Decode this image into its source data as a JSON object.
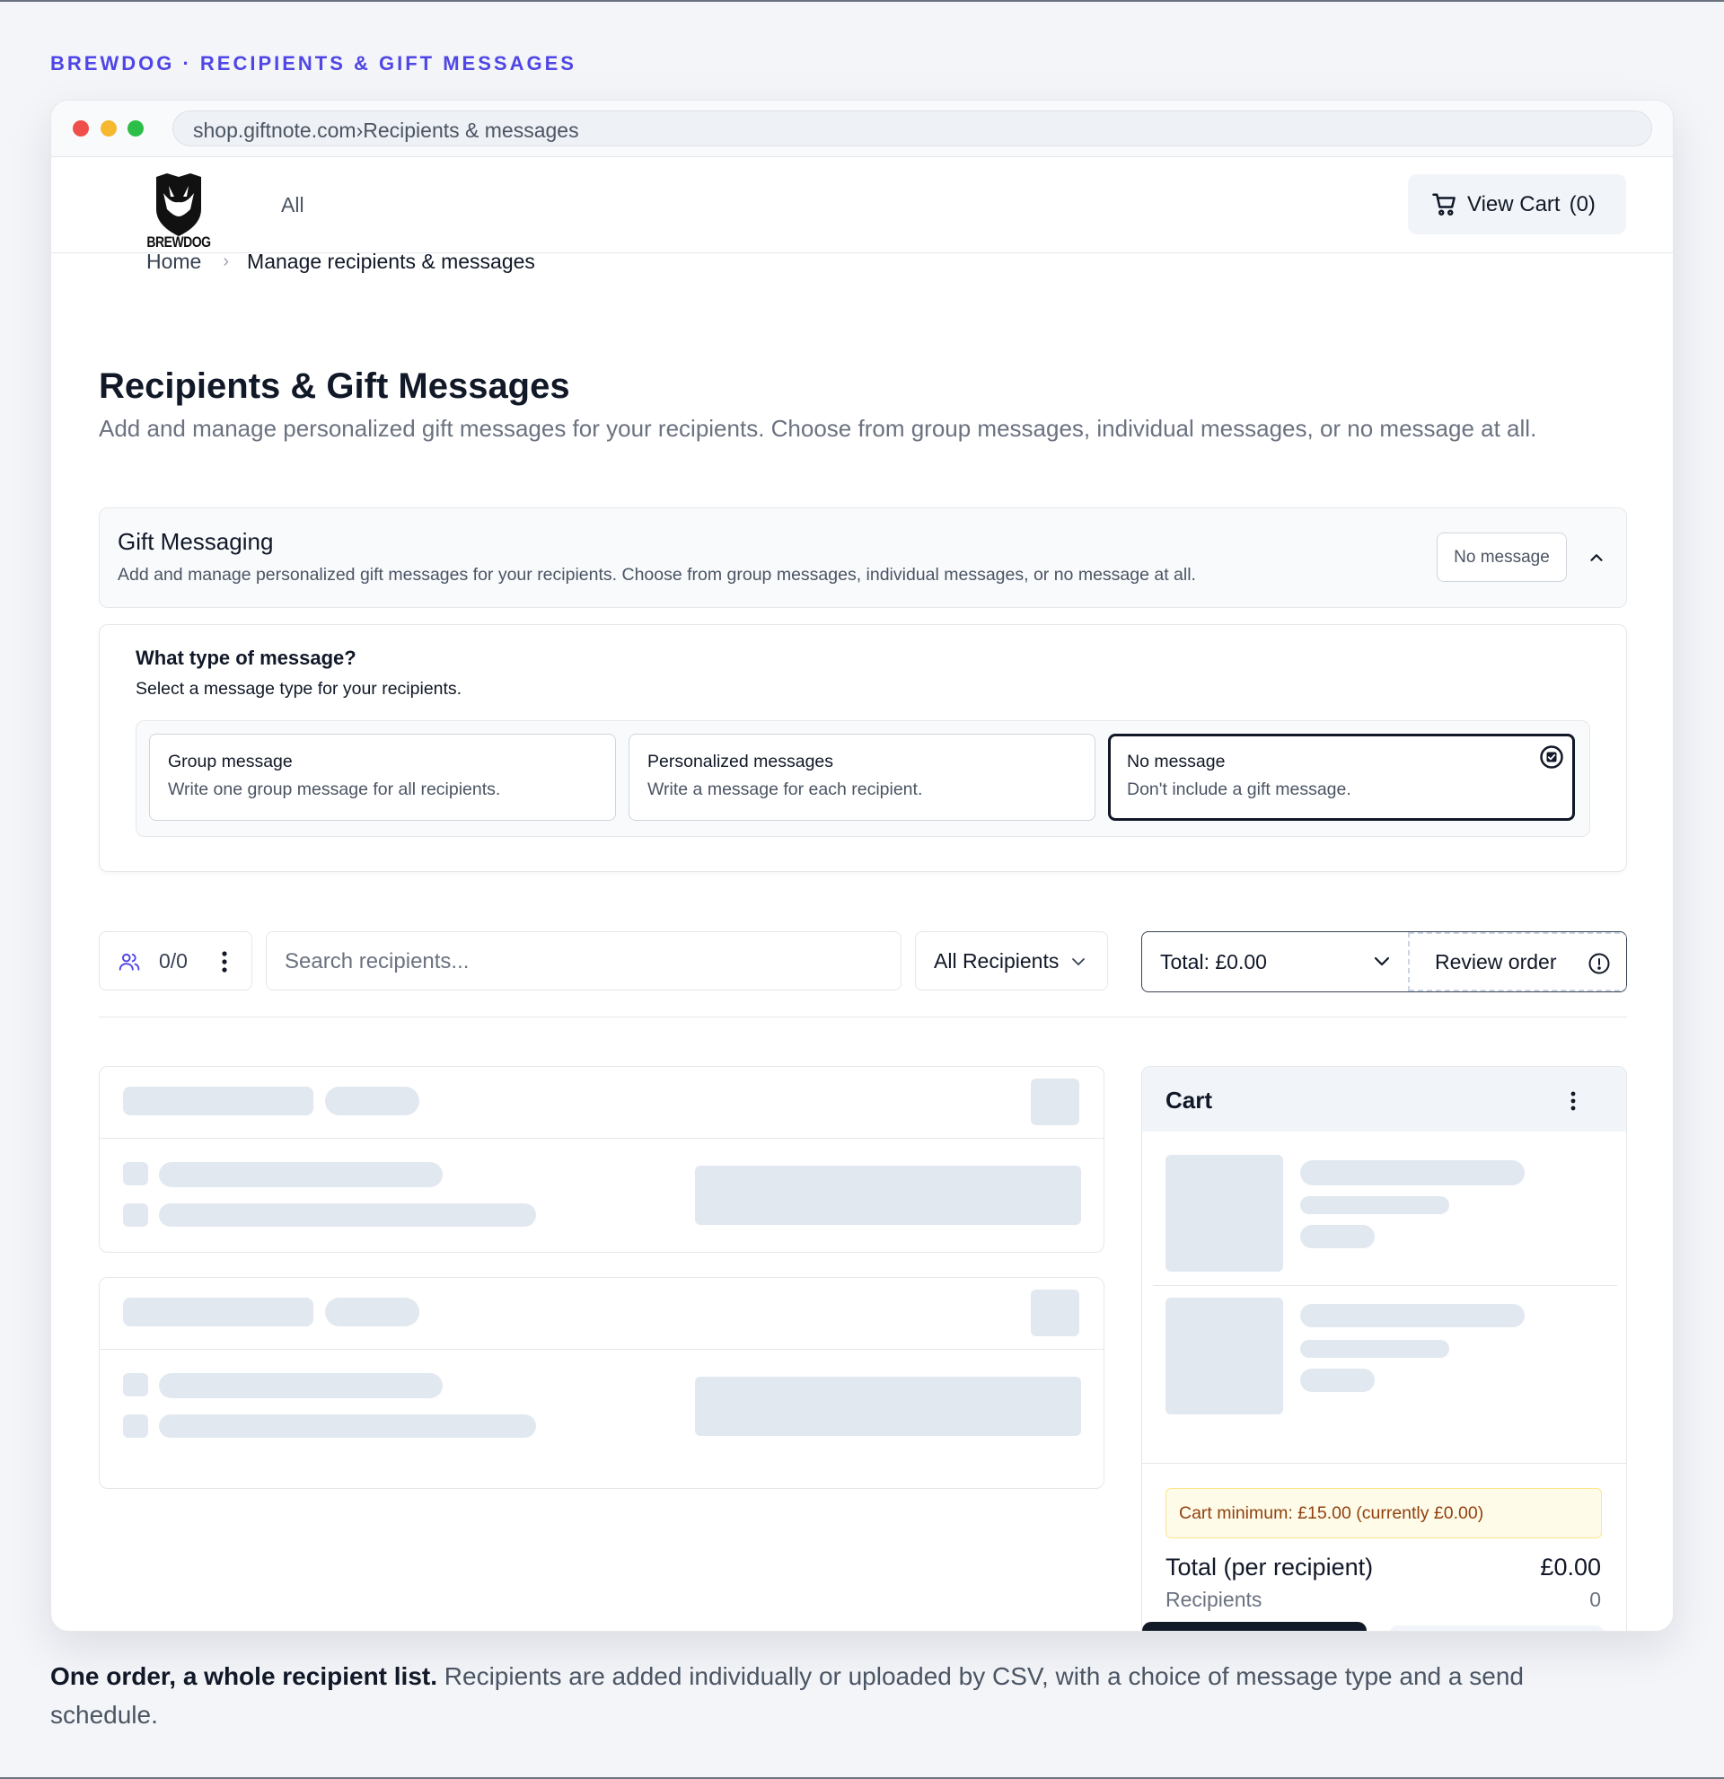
{
  "eyebrow": "BREWDOG · RECIPIENTS & GIFT MESSAGES",
  "browser": {
    "url_host": "shop.giftnote.com",
    "url_path": "Recipients & messages",
    "url_separator": "›"
  },
  "nav": {
    "logo_text": "BREWDOG",
    "all_label": "All",
    "cart_label": "View Cart",
    "cart_count": "(0)"
  },
  "breadcrumb": {
    "home": "Home",
    "separator": "›",
    "current": "Manage recipients & messages"
  },
  "page": {
    "title": "Recipients & Gift Messages",
    "subtitle": "Add and manage personalized gift messages for your recipients. Choose from group messages, individual messages, or no message at all."
  },
  "gift_messaging": {
    "title": "Gift Messaging",
    "description": "Add and manage personalized gift messages for your recipients. Choose from group messages, individual messages, or no message at all.",
    "status_badge": "No message",
    "expanded": true
  },
  "message_type": {
    "question": "What type of message?",
    "help": "Select a message type for your recipients.",
    "options": [
      {
        "title": "Group message",
        "description": "Write one group message for all recipients.",
        "selected": false
      },
      {
        "title": "Personalized messages",
        "description": "Write a message for each recipient.",
        "selected": false
      },
      {
        "title": "No message",
        "description": "Don't include a gift message.",
        "selected": true
      }
    ]
  },
  "toolbar": {
    "recipient_count": "0/0",
    "search_placeholder": "Search recipients...",
    "filter_label": "All Recipients",
    "total_label": "Total: £0.00",
    "review_label": "Review order"
  },
  "cart": {
    "title": "Cart",
    "minimum_notice": "Cart minimum: £15.00 (currently £0.00)",
    "total_label": "Total (per recipient)",
    "total_value": "£0.00",
    "recipients_label": "Recipients",
    "recipients_value": "0"
  },
  "caption": {
    "lead": "One order, a whole recipient list.",
    "body": " Recipients are added individually or uploaded by CSV, with a choice of message type and a send schedule."
  },
  "colors": {
    "accent": "#4f46e5",
    "selected_border": "#111827",
    "skeleton": "#e2e8f0",
    "notice_bg": "#fefbe8",
    "notice_text": "#92400e"
  }
}
